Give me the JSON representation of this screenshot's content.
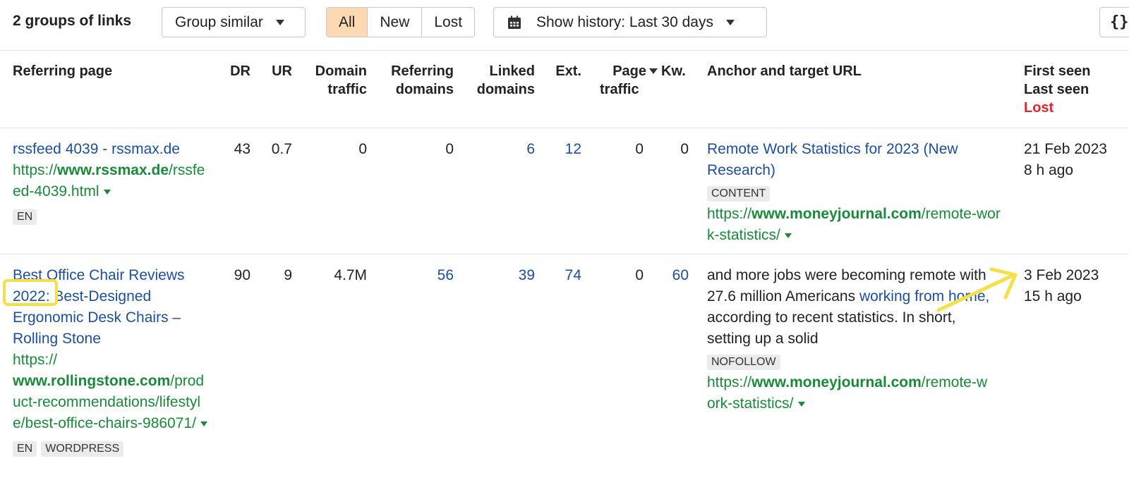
{
  "toolbar": {
    "groups_title": "2 groups of links",
    "group_similar": "Group similar",
    "filters": [
      {
        "label": "All",
        "active": true
      },
      {
        "label": "New",
        "active": false
      },
      {
        "label": "Lost",
        "active": false
      }
    ],
    "history": "Show history: Last 30 days",
    "json_button": "{}"
  },
  "columns": {
    "referring_page": "Referring page",
    "dr": "DR",
    "ur": "UR",
    "domain_traffic_1": "Domain",
    "domain_traffic_2": "traffic",
    "referring_domains_1": "Referring",
    "referring_domains_2": "domains",
    "linked_domains_1": "Linked",
    "linked_domains_2": "domains",
    "ext": "Ext.",
    "page_traffic_1": "Page",
    "page_traffic_2": "traffic",
    "kw": "Kw.",
    "anchor": "Anchor and target URL",
    "first_seen": "First seen",
    "last_seen": "Last seen",
    "lost": "Lost"
  },
  "rows": [
    {
      "title": "rssfeed 4039 - rssmax.de",
      "url_prefix": "https://",
      "url_domain": "www.rssmax.de",
      "url_path": "/rssfeed-4039.html",
      "tags": [
        "EN"
      ],
      "dr": "43",
      "ur": "0.7",
      "domain_traffic": "0",
      "referring_domains": "0",
      "linked_domains": "6",
      "ext": "12",
      "page_traffic": "0",
      "kw": "0",
      "anchor_title": "Remote Work Statistics for 2023 (New Research)",
      "anchor_tag": "CONTENT",
      "target_prefix": "https://",
      "target_domain": "www.moneyjournal.com",
      "target_path": "/remote-work-statistics/",
      "first_seen": "21 Feb 2023",
      "last_seen": "8 h ago"
    },
    {
      "title": "Best Office Chair Reviews 2022: Best-Designed Ergonomic Desk Chairs – Rolling Stone",
      "url_prefix": "https://",
      "url_domain": "www.rollingstone.com",
      "url_path": "/product-recommendations/lifestyle/best-office-chairs-986071/",
      "tags": [
        "EN",
        "WORDPRESS"
      ],
      "dr": "90",
      "ur": "9",
      "domain_traffic": "4.7M",
      "referring_domains": "56",
      "linked_domains": "39",
      "ext": "74",
      "page_traffic": "0",
      "kw": "60",
      "anchor_before": "and more jobs were becoming remote with 27.6 million Americans ",
      "anchor_link": "working from home,",
      "anchor_after": " according to recent statistics. In short, setting up a solid",
      "anchor_tag": "NOFOLLOW",
      "target_prefix": "https://",
      "target_domain": "www.moneyjournal.com",
      "target_path": "/remote-work-statistics/",
      "first_seen": "3 Feb 2023",
      "last_seen": "15 h ago"
    }
  ],
  "annotations": {
    "highlight_color": "#f5e04a"
  }
}
